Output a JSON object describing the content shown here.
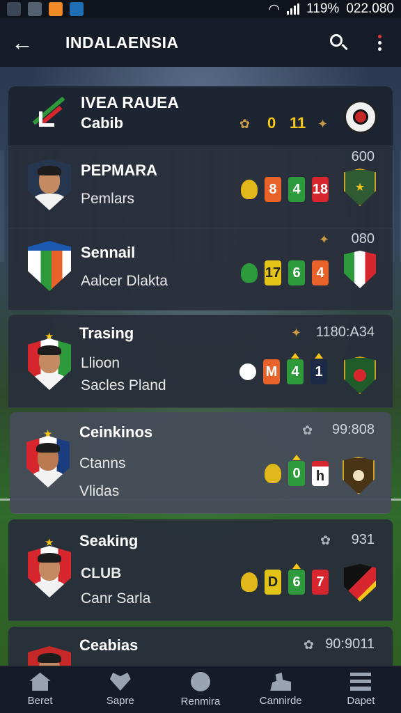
{
  "status_bar": {
    "battery": "119%",
    "time": "022.080"
  },
  "appbar": {
    "title": "INDALAENSIA",
    "back_icon": "arrow-left-icon",
    "search_icon": "search-icon",
    "more_icon": "more-vert-icon"
  },
  "header_card": {
    "title": "IVEA RAUEA",
    "subtitle": "Cabib",
    "stats": [
      "0",
      "11"
    ]
  },
  "rows": [
    {
      "name": "PEPMARA",
      "sub1": "Pemlars",
      "sub2": "",
      "meta": "600",
      "badges": [
        "",
        "8",
        "4",
        "18"
      ]
    },
    {
      "name": "Sennail",
      "sub1": "Aalcer Dlakta",
      "sub2": "",
      "meta": "080",
      "badges": [
        "",
        "17",
        "6",
        "4"
      ]
    },
    {
      "name": "Trasing",
      "sub1": "Llioon",
      "sub2": "Sacles Pland",
      "meta": "1180:A34",
      "badges": [
        "",
        "M",
        "4",
        "1"
      ]
    },
    {
      "name": "Ceinkinos",
      "sub1": "Ctanns",
      "sub2": "Vlidas",
      "meta": "99:808",
      "badges": [
        "",
        "0",
        "h"
      ]
    },
    {
      "name": "Seaking",
      "sub1": "CLUB",
      "sub2": "Canr Sarla",
      "meta": "931",
      "badges": [
        "",
        "D",
        "6",
        "7"
      ]
    },
    {
      "name": "Ceabias",
      "sub1": "",
      "sub2": "",
      "meta": "90:9011",
      "badges": []
    }
  ],
  "bottom_nav": [
    {
      "label": "Beret",
      "icon": "home-icon"
    },
    {
      "label": "Sapre",
      "icon": "heart-icon"
    },
    {
      "label": "Renmira",
      "icon": "compass-icon"
    },
    {
      "label": "Cannirde",
      "icon": "people-icon"
    },
    {
      "label": "Dapet",
      "icon": "menu-icon"
    }
  ],
  "colors": {
    "accent_gold": "#f5c518",
    "badge_red": "#d7262d",
    "badge_green": "#2d9a3c",
    "badge_orange": "#e8622a",
    "appbar_bg": "#161d29"
  }
}
